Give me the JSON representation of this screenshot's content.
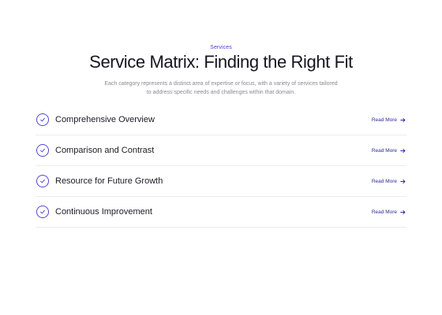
{
  "header": {
    "eyebrow": "Services",
    "title": "Service Matrix: Finding the Right Fit",
    "subtitle": "Each category represents a distinct area of expertise or focus, with a variety of services tailored to address specific needs and challenges within that domain."
  },
  "services": [
    {
      "label": "Comprehensive Overview",
      "link": "Read More"
    },
    {
      "label": "Comparison and Contrast",
      "link": "Read More"
    },
    {
      "label": "Resource for Future Growth",
      "link": "Read More"
    },
    {
      "label": "Continuous Improvement",
      "link": "Read More"
    }
  ],
  "colors": {
    "accent": "#5146d8",
    "link": "#2e2a9c",
    "title": "#15151f",
    "muted": "#8a8a95",
    "divider": "#ececf0"
  }
}
